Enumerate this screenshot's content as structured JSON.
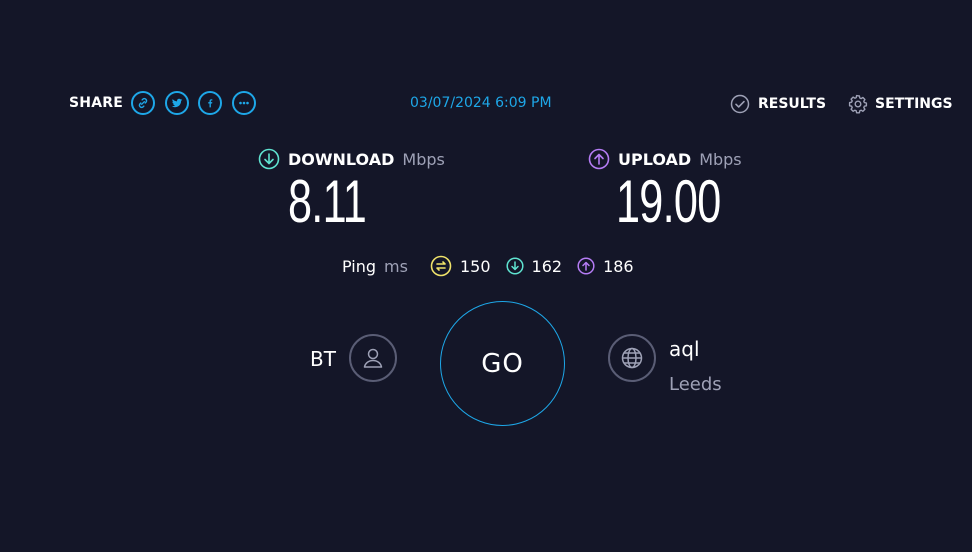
{
  "header": {
    "share_label": "SHARE",
    "share_icons": [
      "link-icon",
      "twitter-icon",
      "facebook-icon",
      "more-icon"
    ],
    "datetime": "03/07/2024 6:09 PM",
    "results_label": "RESULTS",
    "settings_label": "SETTINGS"
  },
  "download": {
    "label": "DOWNLOAD",
    "unit": "Mbps",
    "value": "8.11"
  },
  "upload": {
    "label": "UPLOAD",
    "unit": "Mbps",
    "value": "19.00"
  },
  "ping": {
    "label": "Ping",
    "unit": "ms",
    "idle": "150",
    "download": "162",
    "upload": "186"
  },
  "isp": {
    "name": "BT"
  },
  "go": {
    "label": "GO"
  },
  "server": {
    "name": "aql",
    "location": "Leeds"
  },
  "colors": {
    "background": "#141628",
    "accent": "#1ea7e8",
    "download": "#5fe3d0",
    "upload": "#b57cf5",
    "idle": "#f0e36a",
    "muted": "#9ea1b6"
  }
}
